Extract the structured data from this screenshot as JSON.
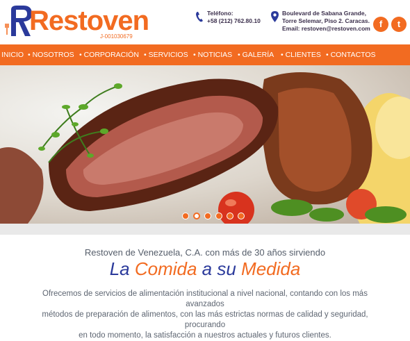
{
  "brand": {
    "name": "Restoven",
    "rif": "J-001030679",
    "orange": "#f26b21",
    "navy": "#2b3a9b"
  },
  "contact": {
    "phone_label": "Teléfono:",
    "phone_number": "+58 (212) 762.80.10",
    "address_line1": "Boulevard de Sabana Grande,",
    "address_line2": "Torre Selemar, Piso 2. Caracas.",
    "email": "Email: restoven@restoven.com"
  },
  "social": {
    "facebook_icon": "f",
    "twitter_icon": "t"
  },
  "nav": {
    "items": [
      {
        "label": "INICIO"
      },
      {
        "label": "• NOSOTROS"
      },
      {
        "label": "• CORPORACIÓN"
      },
      {
        "label": "• SERVICIOS"
      },
      {
        "label": "• NOTICIAS"
      },
      {
        "label": "• GALERÍA"
      },
      {
        "label": "• CLIENTES"
      },
      {
        "label": "• CONTACTOS"
      }
    ]
  },
  "slider": {
    "slide_count": 6,
    "active_index": 1
  },
  "main": {
    "tagline": "Restoven de Venezuela, C.A. con más de 30 años sirviendo",
    "headline_1": "La ",
    "headline_2": "Comida",
    "headline_3": " a su ",
    "headline_4": "Medida",
    "body_line1": "Ofrecemos de servicios de alimentación institucional a nivel nacional, contando con los más avanzados",
    "body_line2": "métodos de preparación de alimentos, con las más estrictas normas de calidad y seguridad, procurando",
    "body_line3": "en todo momento, la satisfacción a nuestros actuales y futuros clientes."
  }
}
